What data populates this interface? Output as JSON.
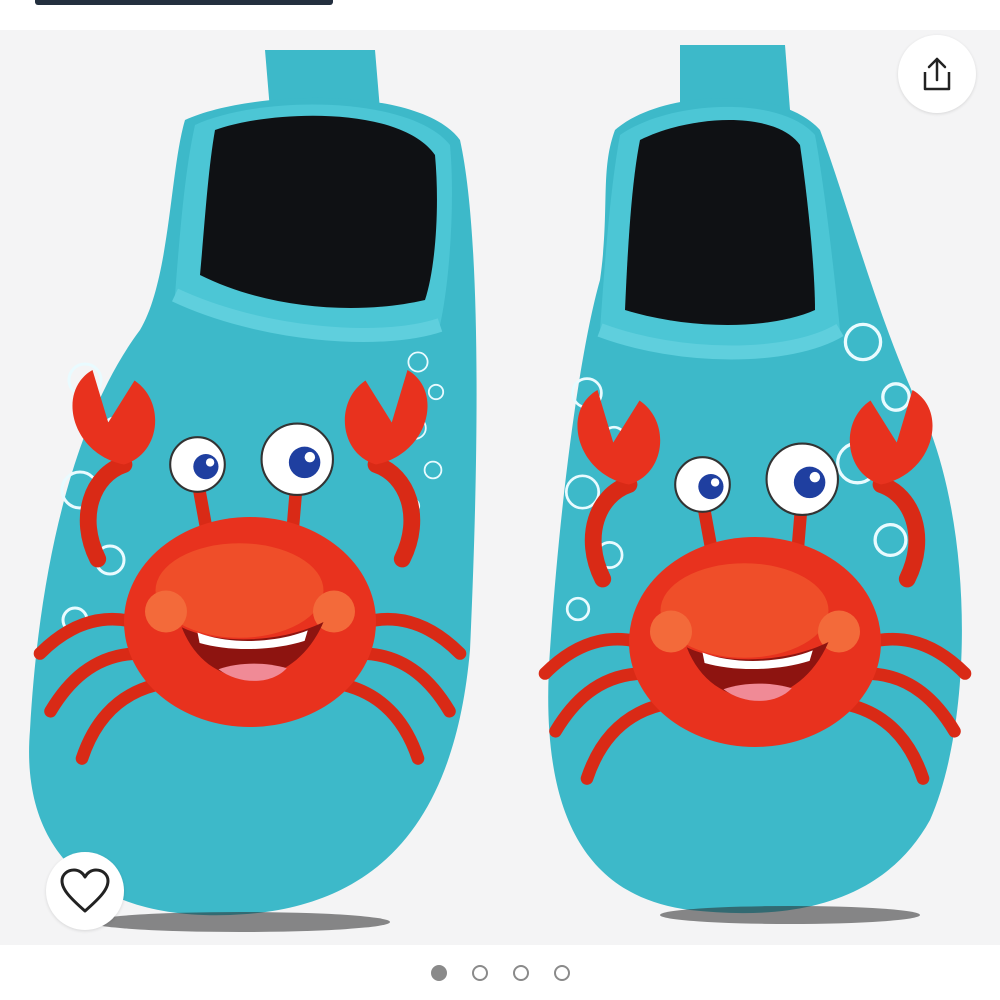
{
  "product_image": {
    "description_icon": "crab-water-shoes-image",
    "shoe_color": "#3db9c9",
    "crab_color": "#e8321e"
  },
  "actions": {
    "share_icon": "share-icon",
    "wishlist_icon": "heart-outline-icon"
  },
  "carousel": {
    "total_images": 4,
    "active_index": 0
  }
}
